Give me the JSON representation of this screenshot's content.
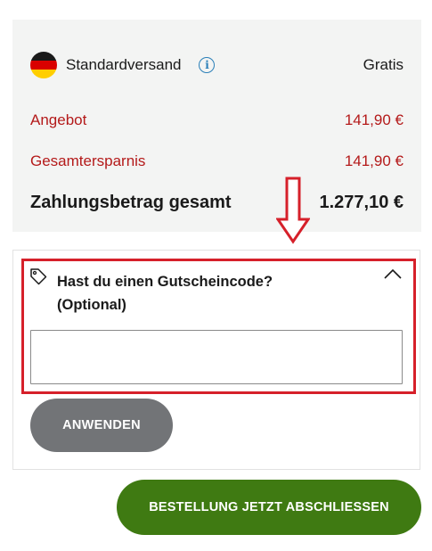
{
  "summary": {
    "shipping": {
      "label": "Standardversand",
      "value": "Gratis",
      "country_flag": "germany-flag",
      "info_icon": "info-icon"
    },
    "offer": {
      "label": "Angebot",
      "value": "141,90 €"
    },
    "savings": {
      "label": "Gesamtersparnis",
      "value": "141,90 €"
    },
    "total": {
      "label": "Zahlungsbetrag gesamt",
      "value": "1.277,10 €"
    }
  },
  "coupon": {
    "icon": "tag-icon",
    "title_line1": "Hast du einen Gutscheincode?",
    "title_line2": "(Optional)",
    "toggle_icon": "chevron-up-icon",
    "input_value": "",
    "input_placeholder": "",
    "apply_label": "ANWENDEN"
  },
  "checkout": {
    "order_label": "BESTELLUNG JETZT ABSCHLIESSEN"
  },
  "annotation": {
    "arrow_icon": "down-arrow-icon",
    "highlight_color": "#d6202a"
  },
  "colors": {
    "summary_bg": "#f3f4f3",
    "price_red": "#b41a1a",
    "info_blue": "#2a7fb8",
    "apply_gray": "#727477",
    "order_green": "#3f7a12"
  }
}
